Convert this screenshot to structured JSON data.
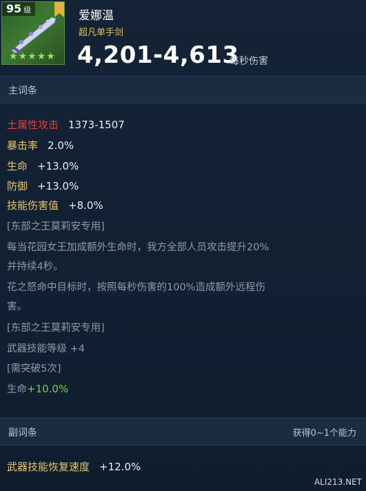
{
  "item": {
    "level_num": "95",
    "level_unit": "级",
    "stars": 5,
    "name": "爱娜温",
    "rarity": "超凡单手剑",
    "dps": "4,201-4,613",
    "dps_unit": "每秒伤害"
  },
  "main_section": {
    "title": "主词条",
    "stats": [
      {
        "label": "土属性攻击",
        "value": "1373-1507"
      },
      {
        "label": "暴击率",
        "value": "2.0%"
      },
      {
        "label": "生命",
        "value": "+13.0%"
      },
      {
        "label": "防御",
        "value": "+13.0%"
      },
      {
        "label": "技能伤害值",
        "value": "+8.0%"
      }
    ],
    "desc_lines": [
      "[东部之王莫莉安专用]",
      "每当花园女王加成额外生命时，我方全部人员攻击提升20%",
      "并持续4秒。",
      "花之怒命中目标时，按照每秒伤害的100%造成额外远程伤",
      "害。",
      "[东部之王莫莉安专用]",
      "武器技能等级 +4",
      "[需突破5次]"
    ],
    "bonus": {
      "label": "生命",
      "value": "+10.0%"
    }
  },
  "sub_section": {
    "title": "副词条",
    "right_note": "获得0~1个能力",
    "stat": {
      "label": "武器技能恢复速度",
      "value": "+12.0%"
    }
  },
  "watermark": "ALI213.NET",
  "colors": {
    "background": "#0e1c2e",
    "section_bar": "#1b2c42",
    "element_red": "#e0413a",
    "stat_gold": "#e9c46a",
    "rarity_gold": "#e6c14a",
    "star_green": "#9be35a",
    "bonus_green": "#6cd64a"
  }
}
